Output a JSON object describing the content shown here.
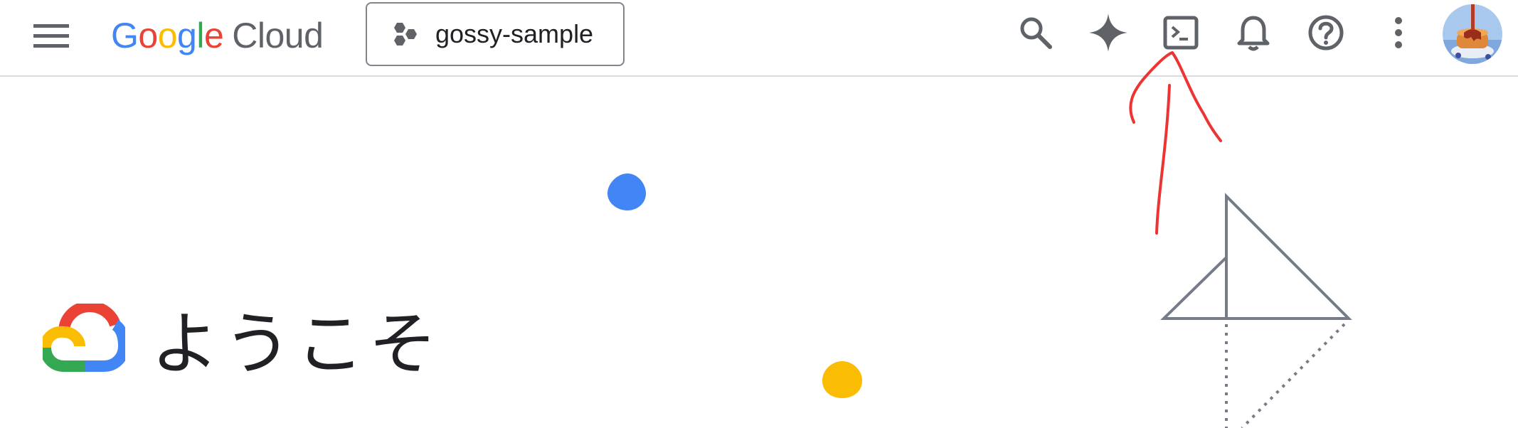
{
  "header": {
    "logo_google": [
      "G",
      "o",
      "o",
      "g",
      "l",
      "e"
    ],
    "logo_cloud": "Cloud",
    "project_name": "gossy-sample"
  },
  "icons": {
    "menu": "hamburger-menu-icon",
    "search": "search-icon",
    "gemini": "gemini-sparkle-icon",
    "cloud_shell": "cloud-shell-terminal-icon",
    "notifications": "bell-icon",
    "help": "help-icon",
    "more": "more-vert-icon",
    "project": "project-hexagon-icon"
  },
  "main": {
    "welcome_text": "ようこそ"
  },
  "colors": {
    "blue": "#4285f4",
    "red": "#ea4335",
    "yellow": "#fbbc04",
    "green": "#34a853",
    "icon_gray": "#5f6368",
    "annotation": "#ee3333"
  }
}
